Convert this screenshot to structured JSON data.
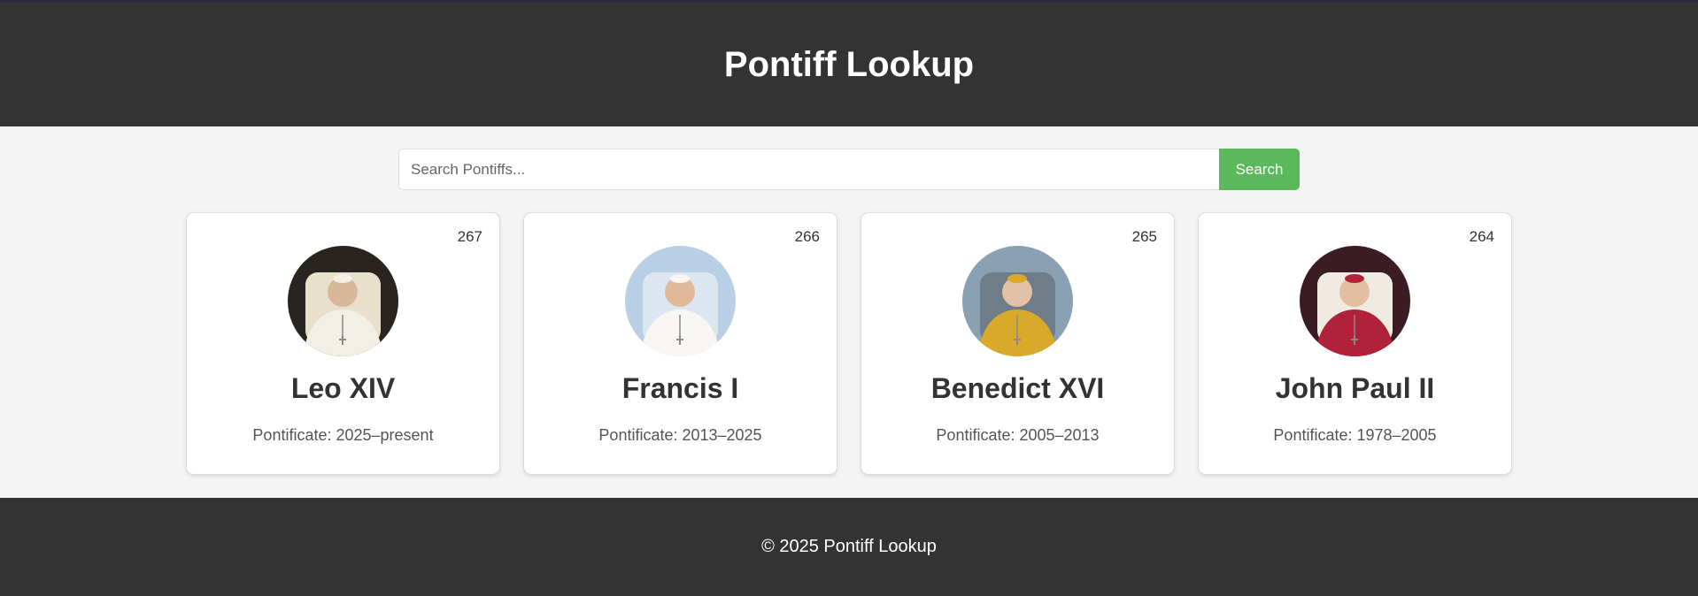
{
  "header": {
    "title": "Pontiff Lookup"
  },
  "search": {
    "placeholder": "Search Pontiffs...",
    "value": "",
    "button_label": "Search"
  },
  "pontiffs": [
    {
      "number": "267",
      "name": "Leo XIV",
      "pontificate": "Pontificate: 2025–present",
      "colors": {
        "bg": "#2a2420",
        "vestment": "#f2efe6",
        "chair": "#e9e0cc",
        "skin": "#d8b79a"
      }
    },
    {
      "number": "266",
      "name": "Francis I",
      "pontificate": "Pontificate: 2013–2025",
      "colors": {
        "bg": "#b9cfe6",
        "vestment": "#f7f6f2",
        "chair": "#dbe6f1",
        "skin": "#e0b89a"
      }
    },
    {
      "number": "265",
      "name": "Benedict XVI",
      "pontificate": "Pontificate: 2005–2013",
      "colors": {
        "bg": "#8aa0b3",
        "vestment": "#d9a929",
        "chair": "#6f7d88",
        "skin": "#e3c1a6"
      }
    },
    {
      "number": "264",
      "name": "John Paul II",
      "pontificate": "Pontificate: 1978–2005",
      "colors": {
        "bg": "#3b1c22",
        "vestment": "#b2213a",
        "chair": "#f0ebe2",
        "skin": "#e2bfa2"
      }
    }
  ],
  "footer": {
    "text": "© 2025 Pontiff Lookup"
  }
}
